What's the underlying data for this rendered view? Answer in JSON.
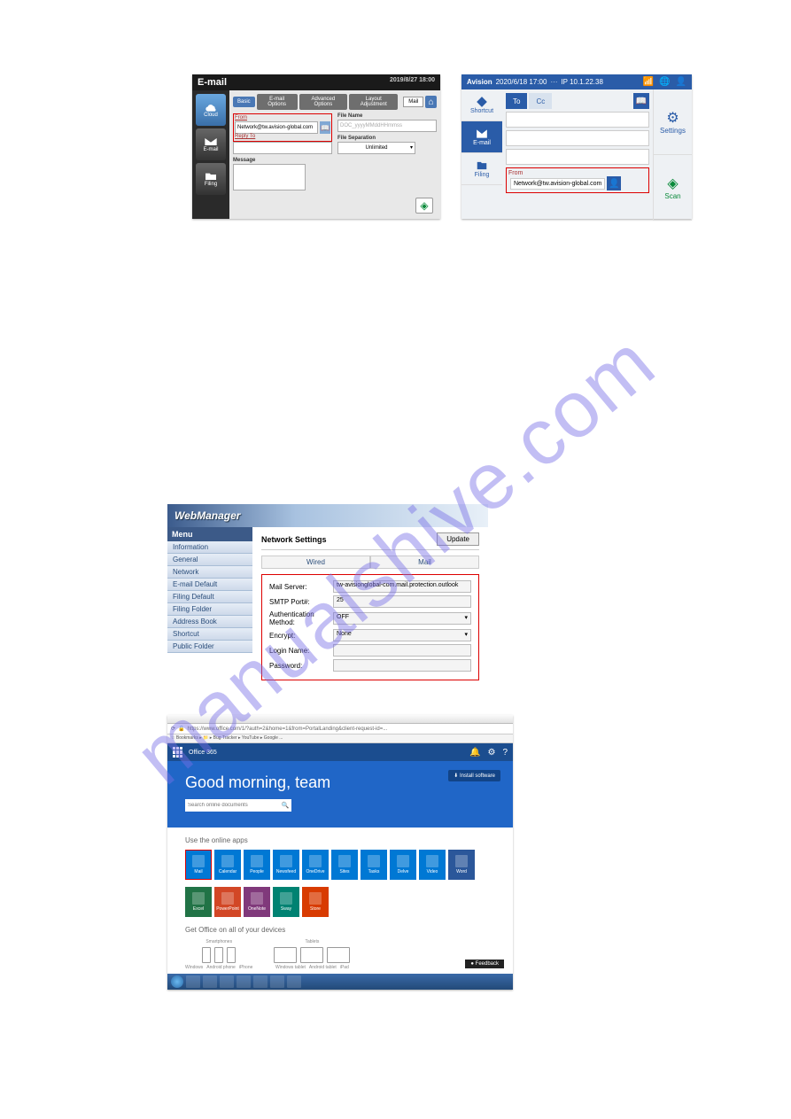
{
  "watermark": "manualshive.com",
  "panel1": {
    "title": "E-mail",
    "timestamp": "2019/8/27 18:00",
    "sidebar": [
      {
        "label": "Cloud"
      },
      {
        "label": "E-mail"
      },
      {
        "label": "Filing"
      }
    ],
    "tabs": [
      "Basic",
      "E-mail Options",
      "Advanced Options",
      "Layout Adjustment"
    ],
    "from_label": "From",
    "from_value": "Network@tw.avision-global.com",
    "reply_label": "Reply To",
    "message_label": "Message",
    "filename_label": "File Name",
    "filename_placeholder": "DOC_yyyyMMddHHmmss",
    "filesep_label": "File Separation",
    "filesep_value": "Unlimited"
  },
  "panel2": {
    "brand": "Avision",
    "datetime": "2020/6/18 17:00",
    "ip": "IP 10.1.22.38",
    "sidebar": [
      "Shortcut",
      "E-mail",
      "Filing"
    ],
    "to": "To",
    "cc": "Cc",
    "from_label": "From",
    "from_value": "Network@tw.avision-global.com",
    "right": [
      "Settings",
      "Scan"
    ]
  },
  "panel3": {
    "title": "WebManager",
    "menu_header": "Menu",
    "menu": [
      "Information",
      "General",
      "Network",
      "E-mail Default",
      "Filing Default",
      "Filing Folder",
      "Address Book",
      "Shortcut",
      "Public Folder"
    ],
    "section": "Network Settings",
    "update": "Update",
    "subtabs": [
      "Wired",
      "Mail"
    ],
    "fields": {
      "mail_server_l": "Mail Server:",
      "mail_server_v": "tw-avisionglobal-com.mail.protection.outlook",
      "port_l": "SMTP Port#:",
      "port_v": "25",
      "auth_l": "Authentication Method:",
      "auth_v": "OFF",
      "encrypt_l": "Encrypt:",
      "encrypt_v": "None",
      "login_l": "Login Name:",
      "password_l": "Password:"
    }
  },
  "panel4": {
    "url": "https://www.office.com/1/?auth=2&home=1&from=PortalLanding&client-request-id=...",
    "brand": "Office 365",
    "install": "⬇ Install software",
    "greeting": "Good morning, team",
    "search_placeholder": "Search online documents",
    "use_apps": "Use the online apps",
    "get_office": "Get Office on all of your devices",
    "dev_groups": [
      "Smartphones",
      "Tablets"
    ],
    "dev_labels_phones": [
      "Windows",
      "Android phone",
      "iPhone"
    ],
    "dev_labels_tabs": [
      "Windows tablet",
      "Android tablet",
      "iPad"
    ],
    "feedback": "● Feedback",
    "apps_row1": [
      {
        "name": "Mail",
        "color": "#0078d4"
      },
      {
        "name": "Calendar",
        "color": "#0078d4"
      },
      {
        "name": "People",
        "color": "#0078d4"
      },
      {
        "name": "Newsfeed",
        "color": "#0078d4"
      },
      {
        "name": "OneDrive",
        "color": "#0078d4"
      },
      {
        "name": "Sites",
        "color": "#0078d4"
      },
      {
        "name": "Tasks",
        "color": "#0078d4"
      },
      {
        "name": "Delve",
        "color": "#0078d4"
      },
      {
        "name": "Video",
        "color": "#0078d4"
      },
      {
        "name": "Word",
        "color": "#2b579a"
      }
    ],
    "apps_row2": [
      {
        "name": "Excel",
        "color": "#217346"
      },
      {
        "name": "PowerPoint",
        "color": "#d24726"
      },
      {
        "name": "OneNote",
        "color": "#80397b"
      },
      {
        "name": "Sway",
        "color": "#008272"
      },
      {
        "name": "Store",
        "color": "#d83b01"
      }
    ]
  }
}
